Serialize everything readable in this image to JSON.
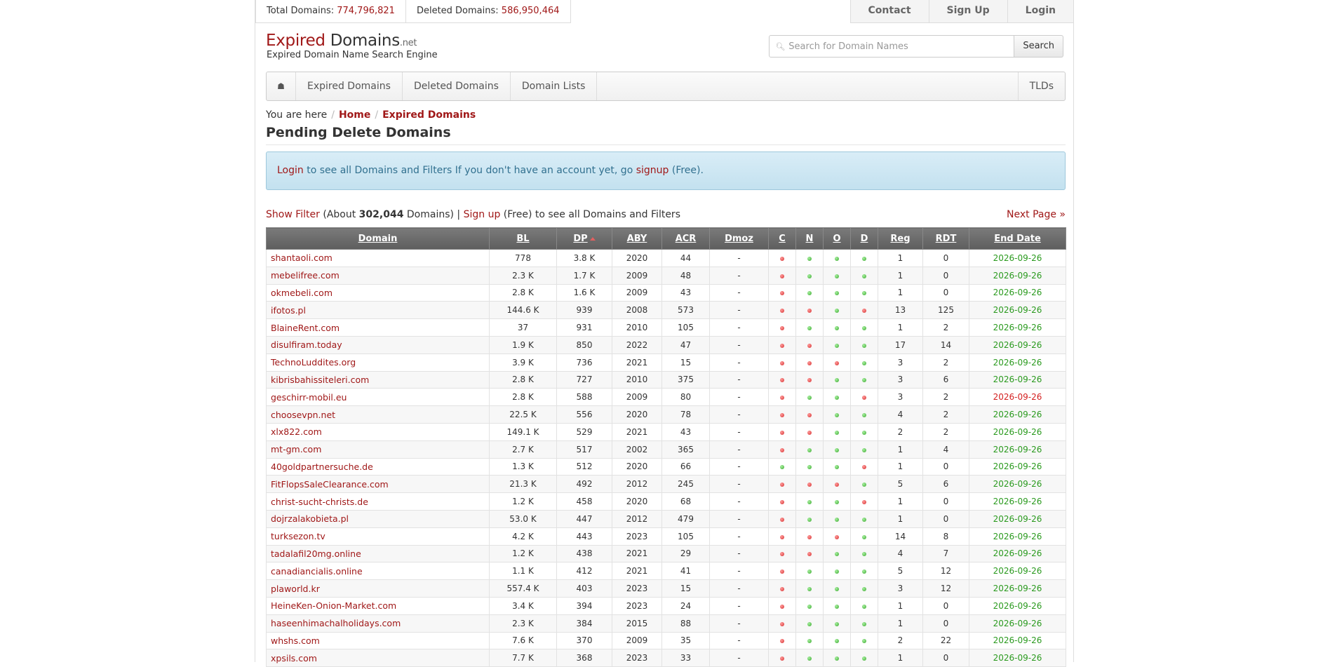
{
  "topbar": {
    "total_label": "Total Domains:",
    "total_value": "774,796,821",
    "deleted_label": "Deleted Domains:",
    "deleted_value": "586,950,464",
    "nav": [
      "Contact",
      "Sign Up",
      "Login"
    ]
  },
  "logo": {
    "expired": "Expired",
    "domains": " Domains",
    "net": ".net",
    "tagline": "Expired Domain Name Search Engine"
  },
  "search": {
    "placeholder": "Search for Domain Names",
    "button": "Search"
  },
  "mainnav": {
    "home_icon": "home-icon",
    "items": [
      "Expired Domains",
      "Deleted Domains",
      "Domain Lists"
    ],
    "right": "TLDs"
  },
  "breadcrumb": {
    "prefix": "You are here",
    "home": "Home",
    "current": "Expired Domains"
  },
  "page_title": "Pending Delete Domains",
  "alert": {
    "login": "Login",
    "text1": " to see all Domains and Filters If you don't have an account yet, go ",
    "signup": "signup",
    "text2": " (Free)."
  },
  "filterbar": {
    "show_filter": "Show Filter",
    "about": " (About ",
    "count": "302,044",
    "domains": " Domains) | ",
    "signup": "Sign up",
    "rest": " (Free) to see all Domains and Filters",
    "next": "Next Page »"
  },
  "colors": {
    "accent": "#a01818",
    "green": "#2a9a1e",
    "red": "#d42020"
  },
  "table": {
    "headers": [
      "Domain",
      "BL",
      "DP",
      "ABY",
      "ACR",
      "Dmoz",
      "C",
      "N",
      "O",
      "D",
      "Reg",
      "RDT",
      "End Date"
    ],
    "rows": [
      {
        "domain": "shantaoli.com",
        "bl": "778",
        "dp": "3.8 K",
        "aby": "2020",
        "acr": "44",
        "dmoz": "-",
        "c": "r",
        "n": "g",
        "o": "g",
        "d": "g",
        "reg": "1",
        "rdt": "0",
        "date": "2026-09-26",
        "date_status": "green"
      },
      {
        "domain": "mebelifree.com",
        "bl": "2.3 K",
        "dp": "1.7 K",
        "aby": "2009",
        "acr": "48",
        "dmoz": "-",
        "c": "r",
        "n": "g",
        "o": "g",
        "d": "g",
        "reg": "1",
        "rdt": "0",
        "date": "2026-09-26",
        "date_status": "green"
      },
      {
        "domain": "okmebeli.com",
        "bl": "2.8 K",
        "dp": "1.6 K",
        "aby": "2009",
        "acr": "43",
        "dmoz": "-",
        "c": "r",
        "n": "g",
        "o": "g",
        "d": "g",
        "reg": "1",
        "rdt": "0",
        "date": "2026-09-26",
        "date_status": "green"
      },
      {
        "domain": "ifotos.pl",
        "bl": "144.6 K",
        "dp": "939",
        "aby": "2008",
        "acr": "573",
        "dmoz": "-",
        "c": "r",
        "n": "r",
        "o": "g",
        "d": "r",
        "reg": "13",
        "rdt": "125",
        "date": "2026-09-26",
        "date_status": "green"
      },
      {
        "domain": "BlaineRent.com",
        "bl": "37",
        "dp": "931",
        "aby": "2010",
        "acr": "105",
        "dmoz": "-",
        "c": "r",
        "n": "g",
        "o": "g",
        "d": "g",
        "reg": "1",
        "rdt": "2",
        "date": "2026-09-26",
        "date_status": "green"
      },
      {
        "domain": "disulfiram.today",
        "bl": "1.9 K",
        "dp": "850",
        "aby": "2022",
        "acr": "47",
        "dmoz": "-",
        "c": "r",
        "n": "r",
        "o": "g",
        "d": "g",
        "reg": "17",
        "rdt": "14",
        "date": "2026-09-26",
        "date_status": "green"
      },
      {
        "domain": "TechnoLuddites.org",
        "bl": "3.9 K",
        "dp": "736",
        "aby": "2021",
        "acr": "15",
        "dmoz": "-",
        "c": "r",
        "n": "r",
        "o": "r",
        "d": "g",
        "reg": "3",
        "rdt": "2",
        "date": "2026-09-26",
        "date_status": "green"
      },
      {
        "domain": "kibrisbahissiteleri.com",
        "bl": "2.8 K",
        "dp": "727",
        "aby": "2010",
        "acr": "375",
        "dmoz": "-",
        "c": "r",
        "n": "r",
        "o": "g",
        "d": "g",
        "reg": "3",
        "rdt": "6",
        "date": "2026-09-26",
        "date_status": "green"
      },
      {
        "domain": "geschirr-mobil.eu",
        "bl": "2.8 K",
        "dp": "588",
        "aby": "2009",
        "acr": "80",
        "dmoz": "-",
        "c": "r",
        "n": "g",
        "o": "g",
        "d": "r",
        "reg": "3",
        "rdt": "2",
        "date": "2026-09-26",
        "date_status": "red"
      },
      {
        "domain": "choosevpn.net",
        "bl": "22.5 K",
        "dp": "556",
        "aby": "2020",
        "acr": "78",
        "dmoz": "-",
        "c": "r",
        "n": "r",
        "o": "g",
        "d": "g",
        "reg": "4",
        "rdt": "2",
        "date": "2026-09-26",
        "date_status": "green"
      },
      {
        "domain": "xlx822.com",
        "bl": "149.1 K",
        "dp": "529",
        "aby": "2021",
        "acr": "43",
        "dmoz": "-",
        "c": "r",
        "n": "r",
        "o": "g",
        "d": "g",
        "reg": "2",
        "rdt": "2",
        "date": "2026-09-26",
        "date_status": "green"
      },
      {
        "domain": "mt-gm.com",
        "bl": "2.7 K",
        "dp": "517",
        "aby": "2002",
        "acr": "365",
        "dmoz": "-",
        "c": "r",
        "n": "g",
        "o": "g",
        "d": "g",
        "reg": "1",
        "rdt": "4",
        "date": "2026-09-26",
        "date_status": "green"
      },
      {
        "domain": "40goldpartnersuche.de",
        "bl": "1.3 K",
        "dp": "512",
        "aby": "2020",
        "acr": "66",
        "dmoz": "-",
        "c": "g",
        "n": "g",
        "o": "g",
        "d": "r",
        "reg": "1",
        "rdt": "0",
        "date": "2026-09-26",
        "date_status": "green"
      },
      {
        "domain": "FitFlopsSaleClearance.com",
        "bl": "21.3 K",
        "dp": "492",
        "aby": "2012",
        "acr": "245",
        "dmoz": "-",
        "c": "r",
        "n": "r",
        "o": "r",
        "d": "g",
        "reg": "5",
        "rdt": "6",
        "date": "2026-09-26",
        "date_status": "green"
      },
      {
        "domain": "christ-sucht-christs.de",
        "bl": "1.2 K",
        "dp": "458",
        "aby": "2020",
        "acr": "68",
        "dmoz": "-",
        "c": "r",
        "n": "g",
        "o": "g",
        "d": "r",
        "reg": "1",
        "rdt": "0",
        "date": "2026-09-26",
        "date_status": "green"
      },
      {
        "domain": "dojrzalakobieta.pl",
        "bl": "53.0 K",
        "dp": "447",
        "aby": "2012",
        "acr": "479",
        "dmoz": "-",
        "c": "r",
        "n": "g",
        "o": "g",
        "d": "g",
        "reg": "1",
        "rdt": "0",
        "date": "2026-09-26",
        "date_status": "green"
      },
      {
        "domain": "turksezon.tv",
        "bl": "4.2 K",
        "dp": "443",
        "aby": "2023",
        "acr": "105",
        "dmoz": "-",
        "c": "r",
        "n": "r",
        "o": "r",
        "d": "g",
        "reg": "14",
        "rdt": "8",
        "date": "2026-09-26",
        "date_status": "green"
      },
      {
        "domain": "tadalafil20mg.online",
        "bl": "1.2 K",
        "dp": "438",
        "aby": "2021",
        "acr": "29",
        "dmoz": "-",
        "c": "r",
        "n": "r",
        "o": "g",
        "d": "g",
        "reg": "4",
        "rdt": "7",
        "date": "2026-09-26",
        "date_status": "green"
      },
      {
        "domain": "canadiancialis.online",
        "bl": "1.1 K",
        "dp": "412",
        "aby": "2021",
        "acr": "41",
        "dmoz": "-",
        "c": "r",
        "n": "g",
        "o": "g",
        "d": "g",
        "reg": "5",
        "rdt": "12",
        "date": "2026-09-26",
        "date_status": "green"
      },
      {
        "domain": "plaworld.kr",
        "bl": "557.4 K",
        "dp": "403",
        "aby": "2023",
        "acr": "15",
        "dmoz": "-",
        "c": "r",
        "n": "g",
        "o": "g",
        "d": "g",
        "reg": "3",
        "rdt": "12",
        "date": "2026-09-26",
        "date_status": "green"
      },
      {
        "domain": "HeineKen-Onion-Market.com",
        "bl": "3.4 K",
        "dp": "394",
        "aby": "2023",
        "acr": "24",
        "dmoz": "-",
        "c": "r",
        "n": "g",
        "o": "g",
        "d": "g",
        "reg": "1",
        "rdt": "0",
        "date": "2026-09-26",
        "date_status": "green"
      },
      {
        "domain": "haseenhimachalholidays.com",
        "bl": "2.3 K",
        "dp": "384",
        "aby": "2015",
        "acr": "88",
        "dmoz": "-",
        "c": "r",
        "n": "g",
        "o": "g",
        "d": "g",
        "reg": "1",
        "rdt": "0",
        "date": "2026-09-26",
        "date_status": "green"
      },
      {
        "domain": "whshs.com",
        "bl": "7.6 K",
        "dp": "370",
        "aby": "2009",
        "acr": "35",
        "dmoz": "-",
        "c": "r",
        "n": "g",
        "o": "g",
        "d": "g",
        "reg": "2",
        "rdt": "22",
        "date": "2026-09-26",
        "date_status": "green"
      },
      {
        "domain": "xpsils.com",
        "bl": "7.7 K",
        "dp": "368",
        "aby": "2023",
        "acr": "33",
        "dmoz": "-",
        "c": "r",
        "n": "g",
        "o": "g",
        "d": "g",
        "reg": "1",
        "rdt": "0",
        "date": "2026-09-26",
        "date_status": "green"
      }
    ]
  }
}
